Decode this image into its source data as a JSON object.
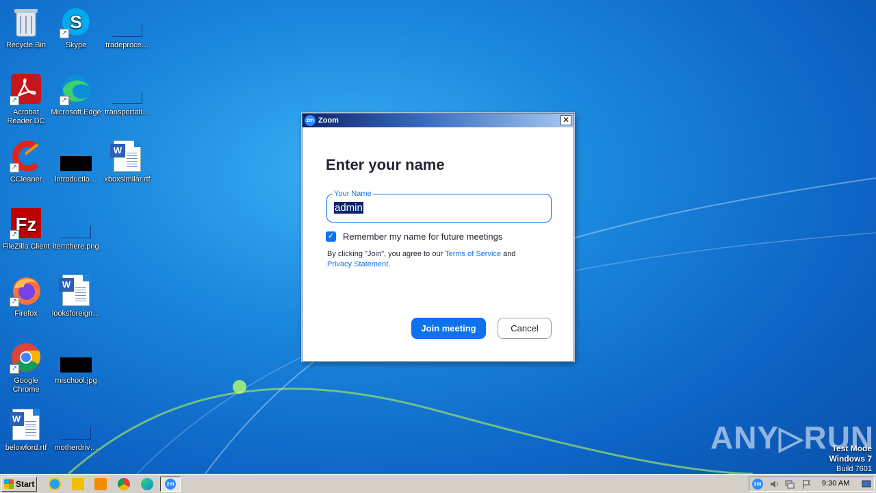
{
  "desktop": {
    "icons": [
      {
        "label": "Recycle Bin",
        "icon": "recycle-bin-icon"
      },
      {
        "label": "Skype",
        "icon": "skype-icon"
      },
      {
        "label": "tradeproce…",
        "icon": "file-icon"
      },
      {
        "label": "Acrobat Reader DC",
        "icon": "acrobat-icon"
      },
      {
        "label": "Microsoft Edge",
        "icon": "edge-icon"
      },
      {
        "label": "transportati…",
        "icon": "file-icon"
      },
      {
        "label": "CCleaner",
        "icon": "ccleaner-icon"
      },
      {
        "label": "introductio…",
        "icon": "image-file-icon"
      },
      {
        "label": "xboxsimilar.rtf",
        "icon": "word-doc-icon"
      },
      {
        "label": "FileZilla Client",
        "icon": "filezilla-icon"
      },
      {
        "label": "itemthere.png",
        "icon": "image-file-icon"
      },
      {
        "label": "Firefox",
        "icon": "firefox-icon"
      },
      {
        "label": "looksforeign…",
        "icon": "word-doc-icon"
      },
      {
        "label": "Google Chrome",
        "icon": "chrome-icon"
      },
      {
        "label": "mischool.jpg",
        "icon": "image-file-icon"
      },
      {
        "label": "belowford.rtf",
        "icon": "word-doc-icon"
      },
      {
        "label": "motherdriv…",
        "icon": "file-icon"
      }
    ]
  },
  "dialog": {
    "title": "Zoom",
    "logo_text": "zm",
    "close_glyph": "✕",
    "heading": "Enter your name",
    "name_field": {
      "label": "Your Name",
      "value": "admin"
    },
    "remember_label": "Remember my name for future meetings",
    "remember_checked": true,
    "legal_prefix": "By clicking \"Join\", you agree to our ",
    "terms_link": "Terms of Service",
    "legal_and": " and",
    "privacy_link": "Privacy Statement",
    "legal_suffix": ".",
    "join_label": "Join meeting",
    "cancel_label": "Cancel"
  },
  "watermark": {
    "brand": "ANY▷RUN",
    "line1": "Test Mode",
    "line2": "Windows 7",
    "line3": "Build 7601"
  },
  "taskbar": {
    "start_label": "Start",
    "clock": "9:30 AM",
    "tray_zoom_text": "zm"
  },
  "colors": {
    "zoom_blue": "#0e72ed",
    "title_gradient_start": "#0b246a"
  }
}
